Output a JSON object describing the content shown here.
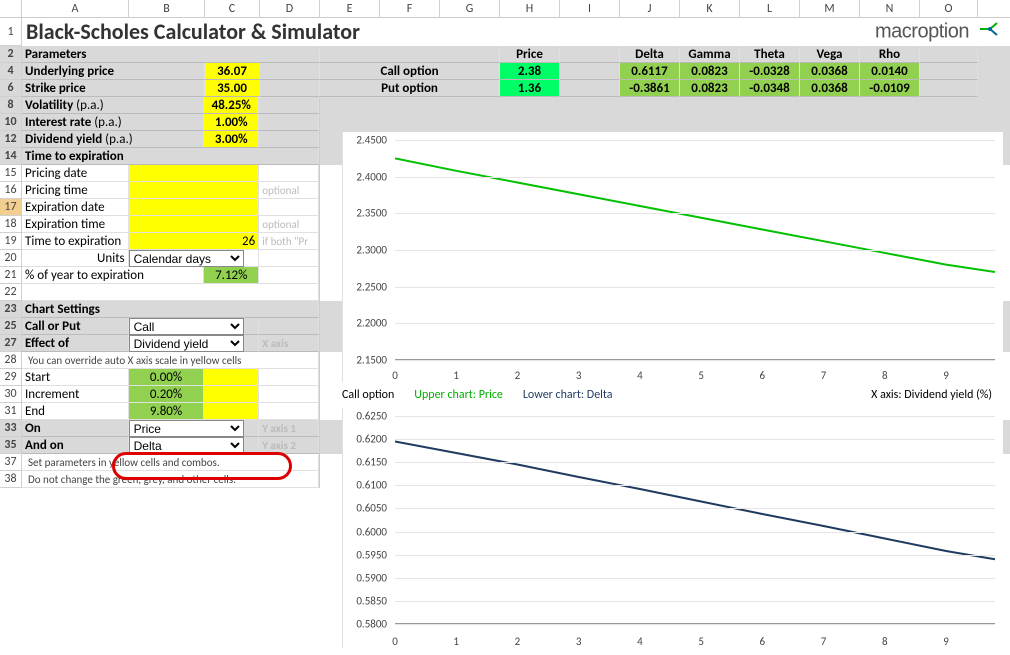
{
  "title": "Black-Scholes Calculator & Simulator",
  "logo_text": "macroption",
  "col_headers": [
    "",
    "A",
    "B",
    "C",
    "D",
    "E",
    "F",
    "G",
    "H",
    "I",
    "J",
    "K",
    "L",
    "M",
    "N",
    "O"
  ],
  "row_numbers": [
    1,
    2,
    4,
    6,
    8,
    10,
    12,
    14,
    15,
    16,
    17,
    18,
    19,
    20,
    21,
    22,
    23,
    25,
    27,
    28,
    29,
    30,
    31,
    33,
    35,
    37,
    38
  ],
  "parameters_label": "Parameters",
  "greeks": {
    "price": "Price",
    "delta": "Delta",
    "gamma": "Gamma",
    "theta": "Theta",
    "vega": "Vega",
    "rho": "Rho"
  },
  "params": {
    "underlying_price": {
      "label": "Underlying price",
      "value": "36.07"
    },
    "strike_price": {
      "label": "Strike price",
      "value": "35.00"
    },
    "volatility": {
      "label_mid": "Volatility",
      "label_suffix": " (p.a.)",
      "value": "48.25%"
    },
    "interest_rate": {
      "label_mid": "Interest rate",
      "label_suffix": " (p.a.)",
      "value": "1.00%"
    },
    "dividend_yield": {
      "label_mid": "Dividend yield",
      "label_suffix": " (p.a.)",
      "value": "3.00%"
    },
    "time_to_exp_hdr": "Time to expiration",
    "pricing_date": "Pricing date",
    "pricing_time": "Pricing time",
    "expiration_date": "Expiration date",
    "expiration_time": "Expiration time",
    "time_to_exp": {
      "label": "Time to expiration",
      "value": "26",
      "note": "if both \"Pr"
    },
    "units": {
      "label": "Units",
      "value": "Calendar days"
    },
    "pct_year": {
      "label": "% of year to expiration",
      "value": "7.12%"
    },
    "optional": "optional"
  },
  "results": {
    "call": {
      "label": "Call option",
      "price": "2.38",
      "delta": "0.6117",
      "gamma": "0.0823",
      "theta": "-0.0328",
      "vega": "0.0368",
      "rho": "0.0140"
    },
    "put": {
      "label": "Put option",
      "price": "1.36",
      "delta": "-0.3861",
      "gamma": "0.0823",
      "theta": "-0.0348",
      "vega": "0.0368",
      "rho": "-0.0109"
    }
  },
  "chart_settings": {
    "header": "Chart Settings",
    "call_or_put": {
      "label": "Call or Put",
      "value": "Call"
    },
    "effect_of": {
      "label": "Effect of",
      "value": "Dividend yield",
      "note": "X axis"
    },
    "override_note": "You can override auto X axis scale in yellow cells",
    "start": {
      "label": "Start",
      "value": "0.00%"
    },
    "increment": {
      "label": "Increment",
      "value": "0.20%"
    },
    "end": {
      "label": "End",
      "value": "9.80%"
    },
    "on": {
      "label": "On",
      "value": "Price",
      "note": "Y axis 1"
    },
    "and_on": {
      "label": "And on",
      "value": "Delta",
      "note": "Y axis 2"
    }
  },
  "footer": {
    "line1": "Set parameters in yellow cells and combos.",
    "line2": "Do not change the green, grey, and other cells."
  },
  "legend": {
    "call_option": "Call option",
    "upper": "Upper chart: Price",
    "lower": "Lower chart: Delta",
    "xaxis": "X axis: Dividend yield (%)"
  },
  "chart_data": [
    {
      "type": "line",
      "title": "",
      "xlabel": "",
      "ylabel": "",
      "x": [
        0,
        1,
        2,
        3,
        4,
        5,
        6,
        7,
        8,
        9,
        9.8
      ],
      "series": [
        {
          "name": "Price",
          "color": "#00c000",
          "values": [
            2.425,
            2.408,
            2.392,
            2.376,
            2.36,
            2.344,
            2.328,
            2.312,
            2.296,
            2.28,
            2.27
          ]
        }
      ],
      "ylim": [
        2.15,
        2.45
      ],
      "yticks": [
        2.15,
        2.2,
        2.25,
        2.3,
        2.35,
        2.4,
        2.45
      ],
      "xticks": [
        0,
        1,
        2,
        3,
        4,
        5,
        6,
        7,
        8,
        9
      ],
      "xlim": [
        0,
        9.8
      ]
    },
    {
      "type": "line",
      "title": "",
      "xlabel": "",
      "ylabel": "",
      "x": [
        0,
        1,
        2,
        3,
        4,
        5,
        6,
        7,
        8,
        9,
        9.8
      ],
      "series": [
        {
          "name": "Delta",
          "color": "#1f3a5f",
          "values": [
            0.6195,
            0.617,
            0.6145,
            0.6118,
            0.6092,
            0.6065,
            0.6038,
            0.6012,
            0.5985,
            0.5958,
            0.594
          ]
        }
      ],
      "ylim": [
        0.58,
        0.625
      ],
      "yticks": [
        0.58,
        0.585,
        0.59,
        0.595,
        0.6,
        0.605,
        0.61,
        0.615,
        0.62,
        0.625
      ],
      "xticks": [
        0,
        1,
        2,
        3,
        4,
        5,
        6,
        7,
        8,
        9
      ],
      "xlim": [
        0,
        9.8
      ]
    }
  ]
}
